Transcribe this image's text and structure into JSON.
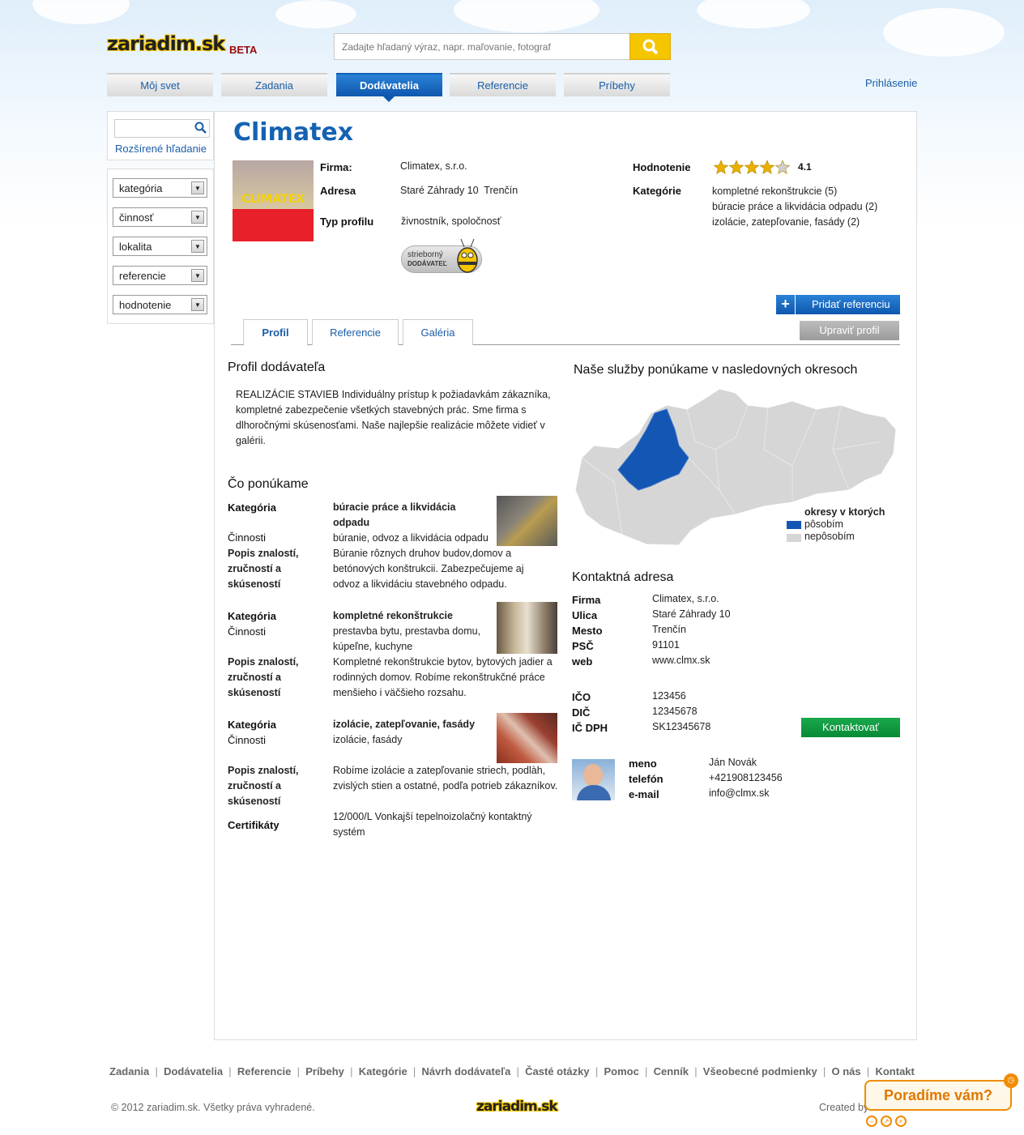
{
  "header": {
    "logo": "zariadim.sk",
    "beta": "BETA",
    "search_placeholder": "Zadajte hľadaný výraz, napr. maľovanie, fotograf",
    "login": "Prihlásenie"
  },
  "nav": {
    "tabs": [
      "Môj svet",
      "Zadania",
      "Dodávatelia",
      "Referencie",
      "Príbehy"
    ],
    "active": "Dodávatelia"
  },
  "sidebar": {
    "advanced_search": "Rozšírené hľadanie",
    "filters": [
      "kategória",
      "činnosť",
      "lokalita",
      "referencie",
      "hodnotenie"
    ]
  },
  "profile": {
    "name": "Climatex",
    "logo_text": "CLIMATEX",
    "firma_label": "Firma:",
    "firma": "Climatex, s.r.o.",
    "adresa_label": "Adresa",
    "adresa": "Staré Záhrady 10  Trenčín",
    "typ_label": "Typ profilu",
    "typ": "živnostník, spoločnosť",
    "badge_line1": "strieborný",
    "badge_line2": "DODÁVATEĽ",
    "rating_label": "Hodnotenie",
    "rating": "4.1",
    "rating_value": 4.1,
    "kategorie_label": "Kategórie",
    "kategorie": [
      "kompletné rekonštrukcie (5)",
      "búracie práce a likvidácia odpadu (2)",
      "izolácie, zatepľovanie, fasády (2)"
    ]
  },
  "actions": {
    "add_reference": "Pridať referenciu",
    "edit_profile": "Upraviť profil",
    "contact": "Kontaktovať"
  },
  "tabs": {
    "items": [
      "Profil",
      "Referencie",
      "Galéria"
    ],
    "active": "Profil"
  },
  "about": {
    "heading": "Profil dodávateľa",
    "text": "REALIZÁCIE STAVIEB Individuálny prístup k požiadavkám zákazníka, kompletné zabezpečenie všetkých stavebných prác. Sme firma s dlhoročnými skúsenosťami. Naše najlepšie realizácie môžete vidieť v galérii."
  },
  "offers": {
    "heading": "Čo ponúkame",
    "labels": {
      "kategoria": "Kategória",
      "cinnosti": "Činnosti",
      "popis": "Popis znalostí, zručností a skúseností",
      "cert": "Certifikáty"
    },
    "items": [
      {
        "kategoria": "búracie práce a likvidácia odpadu",
        "cinnosti": "búranie, odvoz a likvidácia odpadu",
        "popis": "Búranie rôznych druhov budov,domov a betónových konštrukcii. Zabezpečujeme aj odvoz a likvidáciu stavebného odpadu."
      },
      {
        "kategoria": "kompletné rekonštrukcie",
        "cinnosti": "prestavba bytu, prestavba domu, kúpeľne, kuchyne",
        "popis": "Kompletné rekonštrukcie bytov, bytových jadier a rodinných domov. Robíme rekonštrukčné práce menšieho i väčšieho rozsahu."
      },
      {
        "kategoria": "izolácie, zatepľovanie, fasády",
        "cinnosti": "izolácie, fasády",
        "popis": "Robíme izolácie a zatepľovanie striech, podlàh, zvislých stien a ostatné, podľa potrieb zákazníkov.",
        "cert": "12/000/L Vonkajší tepelnoizolačný kontaktný systém"
      }
    ]
  },
  "map": {
    "heading": "Naše služby ponúkame v nasledovných okresoch",
    "legend_title": "okresy v ktorých",
    "legend_active": "pôsobím",
    "legend_inactive": "nepôsobím",
    "colors": {
      "active": "#1456b4",
      "inactive": "#d6d6d6"
    }
  },
  "contact": {
    "heading": "Kontaktná adresa",
    "rows": [
      [
        "Firma",
        "Climatex, s.r.o."
      ],
      [
        "Ulica",
        "Staré Záhrady 10"
      ],
      [
        "Mesto",
        "Trenčín"
      ],
      [
        "PSČ",
        "91101"
      ],
      [
        "web",
        "www.clmx.sk"
      ]
    ],
    "ids": [
      [
        "IČO",
        "123456"
      ],
      [
        "DIČ",
        "12345678"
      ],
      [
        "IČ DPH",
        "SK12345678"
      ]
    ],
    "person": [
      [
        "meno",
        "Ján Novák"
      ],
      [
        "telefón",
        "+421908123456"
      ],
      [
        "e-mail",
        "info@clmx.sk"
      ]
    ]
  },
  "footer": {
    "links": [
      "Zadania",
      "Dodávatelia",
      "Referencie",
      "Príbehy",
      "Kategórie",
      "Návrh dodávateľa",
      "Časté otázky",
      "Pomoc",
      "Cenník",
      "Všeobecné podmienky",
      "O nás",
      "Kontakt"
    ],
    "copyright": "© 2012 zariadim.sk. Všetky práva vyhradené.",
    "logo": "zariadim.sk",
    "created": "Created by",
    "help": "Poradíme vám?"
  }
}
